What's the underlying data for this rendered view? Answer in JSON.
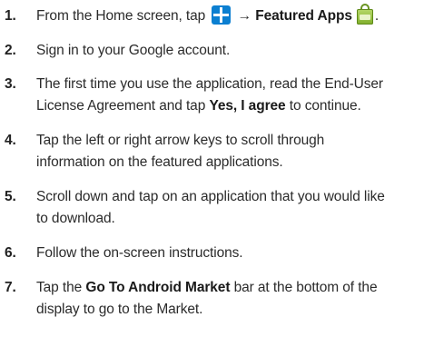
{
  "steps": [
    {
      "num": "1.",
      "parts": [
        "From the Home screen, tap ",
        " → ",
        "Featured Apps",
        "."
      ]
    },
    {
      "num": "2.",
      "line1": "Sign in to your Google account."
    },
    {
      "num": "3.",
      "line1": "The first time you use the application, read the End-User",
      "line2_pre": "License Agreement and tap ",
      "line2_bold": "Yes, I agree",
      "line2_post": " to continue."
    },
    {
      "num": "4.",
      "line1": "Tap the left or right arrow keys to scroll through",
      "line2": "information on the featured applications."
    },
    {
      "num": "5.",
      "line1": "Scroll down and tap on an application that you would like",
      "line2": "to download."
    },
    {
      "num": "6.",
      "line1": "Follow the on-screen instructions."
    },
    {
      "num": "7.",
      "line1_pre": "Tap the ",
      "line1_bold": "Go To Android Market",
      "line1_post": " bar at the bottom of the",
      "line2": "display to go to the Market."
    }
  ],
  "icons": {
    "apps_grid": "apps-grid-icon",
    "featured_apps": "shopping-bag-icon",
    "apps_grid_color": "#0b7fd1",
    "featured_apps_color": "#8fbd3a"
  }
}
